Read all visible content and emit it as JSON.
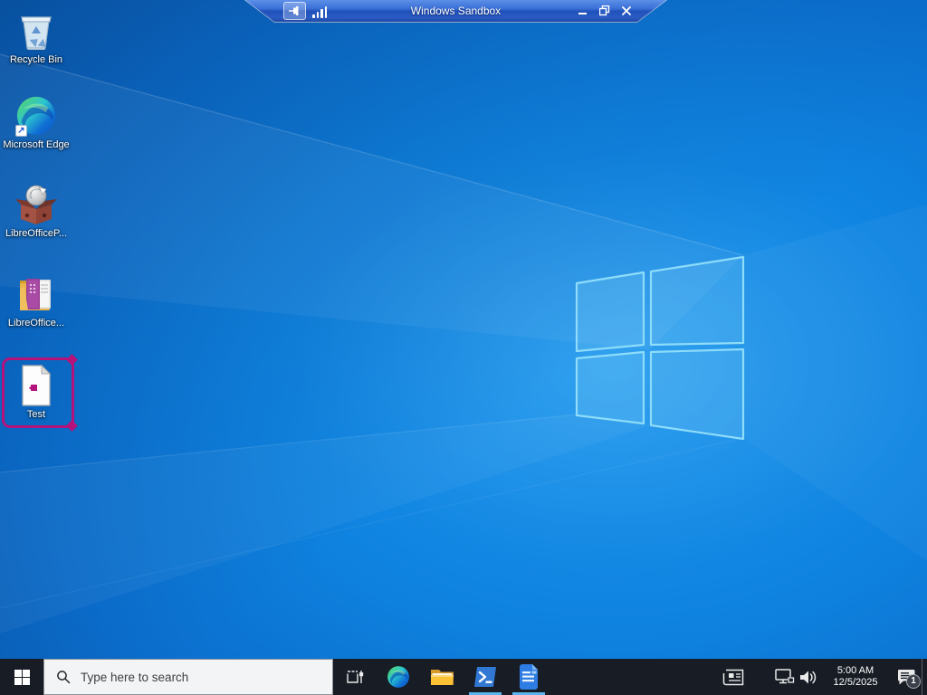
{
  "window": {
    "title": "Windows Sandbox",
    "controls": {
      "minimize": "minimize",
      "restore": "restore",
      "close": "close"
    }
  },
  "desktop": {
    "icons": [
      {
        "label": "Recycle Bin"
      },
      {
        "label": "Microsoft Edge"
      },
      {
        "label": "LibreOfficeP..."
      },
      {
        "label": "LibreOffice..."
      },
      {
        "label": "Test",
        "annotated": true
      }
    ]
  },
  "taskbar": {
    "search_placeholder": "Type here to search",
    "clock": {
      "time": "5:00 AM",
      "date": "12/5/2025"
    },
    "notification_count": "1"
  },
  "colors": {
    "annotation": "#b3137a",
    "taskbar_bg": "#171c25",
    "running_indicator": "#5ab4ee",
    "wallpaper_base": "#0f7fdc",
    "connection_bar": "#2b5cc4",
    "logo_edge": "#8ddcf9"
  }
}
